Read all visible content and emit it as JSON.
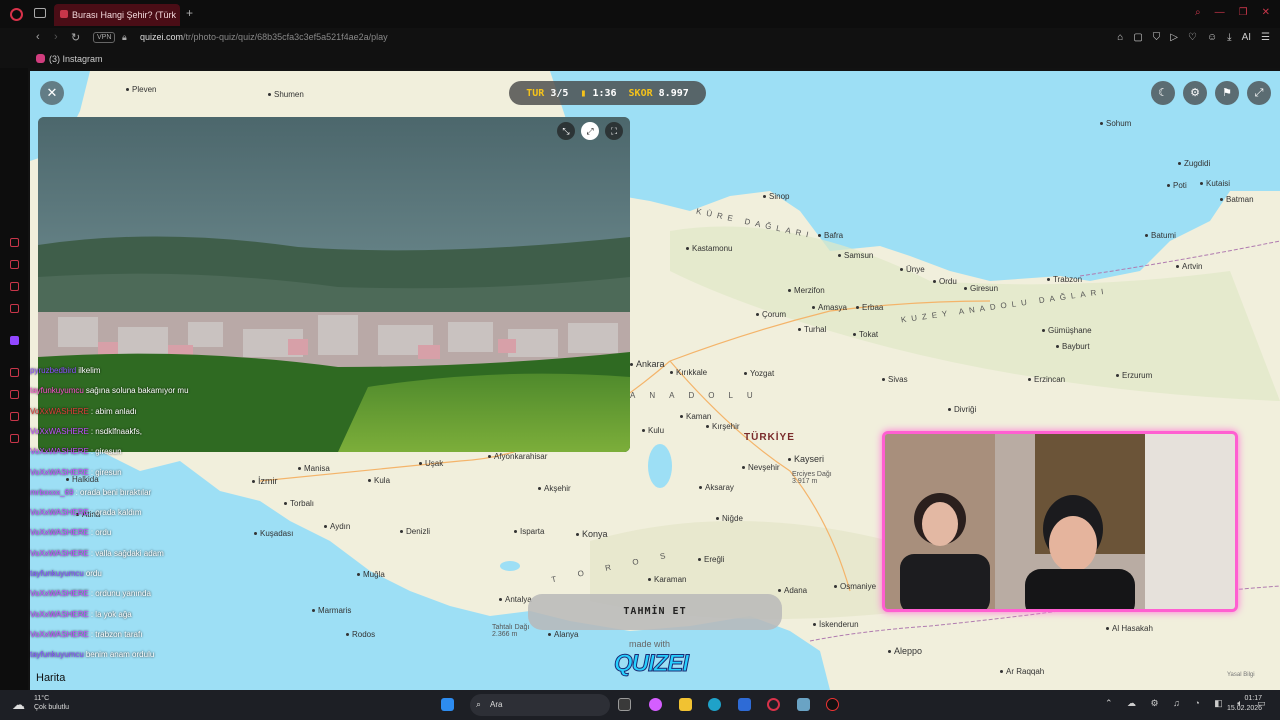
{
  "browser": {
    "tab_title": "Burası Hangi Şehir? (Türk",
    "url_host": "quizei.com",
    "url_path": "/tr/photo-quiz/quiz/68b35cfa3c3ef5a521f4ae2a/play",
    "vpn_label": "VPN",
    "bookmark": "(3) Instagram",
    "ai_label": "AI"
  },
  "hud": {
    "round_label": "TUR",
    "round_value": "3/5",
    "timer_value": "1:36",
    "score_label": "SKOR",
    "score_value": "8.997"
  },
  "map": {
    "country_label": "TÜRKİYE",
    "cities": {
      "kastamonu": "Kastamonu",
      "sinop": "Sinop",
      "samsun": "Samsun",
      "bafra": "Bafra",
      "unye": "Ünye",
      "ordu": "Ordu",
      "giresun": "Giresun",
      "trabzon": "Trabzon",
      "rize": "Rize",
      "artvin": "Artvin",
      "batumi": "Batumi",
      "poti": "Poti",
      "kutaisi": "Kutaisi",
      "zugdidi": "Zugdidi",
      "sohumi": "Sohum",
      "corum": "Çorum",
      "merzifon": "Merzifon",
      "amasya": "Amasya",
      "tokat": "Tokat",
      "erbaa": "Erbaa",
      "turhal": "Turhal",
      "ankara": "Ankara",
      "kirikkale": "Kırıkkale",
      "yozgat": "Yozgat",
      "sivas": "Sivas",
      "erzincan": "Erzincan",
      "erzurum": "Erzurum",
      "bayburt": "Bayburt",
      "gumushane": "Gümüşhane",
      "divrigi": "Divriği",
      "kaman": "Kaman",
      "kirsehir": "Kırşehir",
      "kayseri": "Kayseri",
      "nevsehir": "Nevşehir",
      "aksaray": "Aksaray",
      "nigde": "Niğde",
      "eregli": "Ereğli",
      "karaman": "Karaman",
      "konya": "Konya",
      "adana": "Adana",
      "osmaniye": "Osmaniye",
      "iskenderun": "İskenderun",
      "aleppo": "Aleppo",
      "hasakah": "Al Hasakah",
      "raqqah": "Ar Raqqah",
      "antalya": "Antalya",
      "alanya": "Alanya",
      "mugla": "Muğla",
      "rodos": "Rodos",
      "denizli": "Denizli",
      "aydin": "Aydın",
      "izmir": "İzmir",
      "manisa": "Manisa",
      "usak": "Uşak",
      "kula": "Kula",
      "afyonkarahisar": "Afyonkarahisar",
      "isparta": "Isparta",
      "aksehir": "Akşehir",
      "atina": "Atina",
      "halkida": "Halkida",
      "pleven": "Pleven",
      "shumen": "Shumen",
      "kulu": "Kulu",
      "ubuk": "ubuk",
      "kusadasi": "Kuşadası",
      "torbali": "Torbalı",
      "marmaris": "Marmaris",
      "batman": "Batman"
    },
    "regions": {
      "kure": "KÜRE DAĞLARI",
      "kuzey": "KUZEY ANADOLU DAĞLARI",
      "anadolu": "ANADOLU",
      "toros": "TOROS"
    },
    "peaks": {
      "erciyes": "Erciyes Dağı\n3.917 m",
      "tahtali": "Tahtalı Dağı\n2.366 m"
    },
    "road_labels": [
      "E80",
      "E88",
      "E80",
      "E772"
    ],
    "attribution": "Harita",
    "yasal": "Yasal Bilgi"
  },
  "chat": [
    {
      "user": "pyruzbedbird",
      "msg": "ilkelim",
      "color": "#8a4dff"
    },
    {
      "user": "tayfunkuyumcu",
      "msg": "sağına soluna bakamıyor mu",
      "color": "#ff4fd2"
    },
    {
      "user": "VoXxWASHERE",
      "msg": ": abim anladı",
      "color": "#e03c3c"
    },
    {
      "user": "VoXxWASHERE",
      "msg": ": nsdklfnaakfs,",
      "color": "#c24dff"
    },
    {
      "user": "VoXxWASHERE",
      "msg": ": giresun",
      "color": "#c24dff"
    },
    {
      "user": "VoXxWASHERE",
      "msg": ": giresun",
      "color": "#c24dff"
    },
    {
      "user": "mrboxxx_69",
      "msg": ": orada beni bıraktılar",
      "color": "#c24dff"
    },
    {
      "user": "VoXxWASHERE",
      "msg": ": orada kaldım",
      "color": "#c24dff"
    },
    {
      "user": "VoXxWASHERE",
      "msg": ": ordu",
      "color": "#c24dff"
    },
    {
      "user": "VoXxWASHERE",
      "msg": ": valla sağdaki adam",
      "color": "#c24dff"
    },
    {
      "user": "tayfunkuyumcu",
      "msg": "ordu",
      "color": "#8a4dff"
    },
    {
      "user": "VoXxWASHERE",
      "msg": ": ordunu yanında",
      "color": "#c24dff"
    },
    {
      "user": "VoXxWASHERE",
      "msg": ": la yok ağa",
      "color": "#c24dff"
    },
    {
      "user": "VoXxWASHERE",
      "msg": ": trabzon tarafı",
      "color": "#c24dff"
    },
    {
      "user": "tayfunkuyumcu",
      "msg": "benim anam ordulu",
      "color": "#8a4dff"
    }
  ],
  "quiz": {
    "guess_label": "TAHMİN ET",
    "made_with": "made with",
    "brand": "QUIZEI"
  },
  "taskbar": {
    "weather_temp": "11°C",
    "weather_desc": "Çok bulutlu",
    "search_placeholder": "Ara",
    "time": "01:17",
    "date": "15.02.2026"
  },
  "colors": {
    "sea": "#9ddff5",
    "land": "#f1efdc",
    "accent": "#d8324a",
    "webcam_border": "#ff5fd1",
    "score_key": "#f4c21b"
  }
}
